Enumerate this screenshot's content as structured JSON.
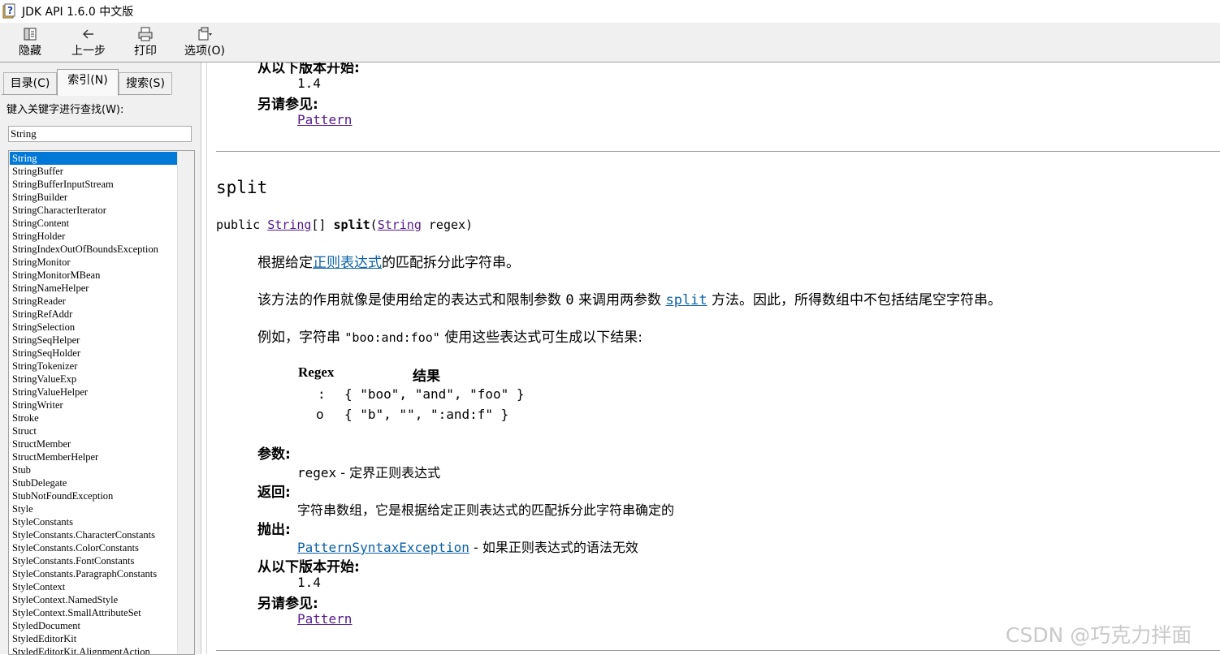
{
  "window": {
    "title": "JDK API 1.6.0 中文版"
  },
  "toolbar": {
    "buttons": [
      {
        "label": "隐藏",
        "icon": "hide-icon"
      },
      {
        "label": "上一步",
        "icon": "back-arrow-icon"
      },
      {
        "label": "打印",
        "icon": "print-icon"
      },
      {
        "label": "选项(O)",
        "icon": "options-icon"
      }
    ]
  },
  "tabs": [
    {
      "label": "目录(C)"
    },
    {
      "label": "索引(N)",
      "active": true
    },
    {
      "label": "搜索(S)"
    }
  ],
  "index": {
    "keyword_label": "键入关键字进行查找(W):",
    "keyword_value": "String",
    "items": [
      "String",
      "StringBuffer",
      "StringBufferInputStream",
      "StringBuilder",
      "StringCharacterIterator",
      "StringContent",
      "StringHolder",
      "StringIndexOutOfBoundsException",
      "StringMonitor",
      "StringMonitorMBean",
      "StringNameHelper",
      "StringReader",
      "StringRefAddr",
      "StringSelection",
      "StringSeqHelper",
      "StringSeqHolder",
      "StringTokenizer",
      "StringValueExp",
      "StringValueHelper",
      "StringWriter",
      "Stroke",
      "Struct",
      "StructMember",
      "StructMemberHelper",
      "Stub",
      "StubDelegate",
      "StubNotFoundException",
      "Style",
      "StyleConstants",
      "StyleConstants.CharacterConstants",
      "StyleConstants.ColorConstants",
      "StyleConstants.FontConstants",
      "StyleConstants.ParagraphConstants",
      "StyleContext",
      "StyleContext.NamedStyle",
      "StyleContext.SmallAttributeSet",
      "StyledDocument",
      "StyledEditorKit",
      "StyledEditorKit.AlignmentAction"
    ],
    "selected_index": 0
  },
  "content": {
    "top_since_label": "从以下版本开始:",
    "top_since_value": "1.4",
    "top_see_also_label": "另请参见:",
    "top_see_also_link": "Pattern",
    "method_name": "split",
    "signature": {
      "prefix": "public ",
      "return_type": "String",
      "after_type": "[] ",
      "name": "split",
      "open": "(",
      "param_type": "String",
      "rest": " regex)"
    },
    "para1": {
      "before": "根据给定",
      "link": "正则表达式",
      "after": "的匹配拆分此字符串。"
    },
    "para2": {
      "before": "该方法的作用就像是使用给定的表达式和限制参数 ",
      "zero": "0",
      "middle": " 来调用两参数 ",
      "link": "split",
      "after": " 方法。因此，所得数组中不包括结尾空字符串。"
    },
    "para3": {
      "before": "例如，字符串 ",
      "code": "\"boo:and:foo\"",
      "after": " 使用这些表达式可生成以下结果:"
    },
    "regex_table": {
      "header_regex": "Regex",
      "header_result": "结果",
      "rows": [
        {
          "regex": ":",
          "result": "{ \"boo\", \"and\", \"foo\" }"
        },
        {
          "regex": "o",
          "result": "{ \"b\", \"\", \":and:f\" }"
        }
      ]
    },
    "params_label": "参数:",
    "params_name": "regex",
    "params_desc": " - 定界正则表达式",
    "returns_label": "返回:",
    "returns_desc": "字符串数组，它是根据给定正则表达式的匹配拆分此字符串确定的",
    "throws_label": "抛出:",
    "throws_link": "PatternSyntaxException",
    "throws_desc": " - 如果正则表达式的语法无效",
    "since_label": "从以下版本开始:",
    "since_value": "1.4",
    "see_also_label": "另请参见:",
    "see_also_link": "Pattern"
  },
  "watermark": "CSDN @巧克力拌面"
}
